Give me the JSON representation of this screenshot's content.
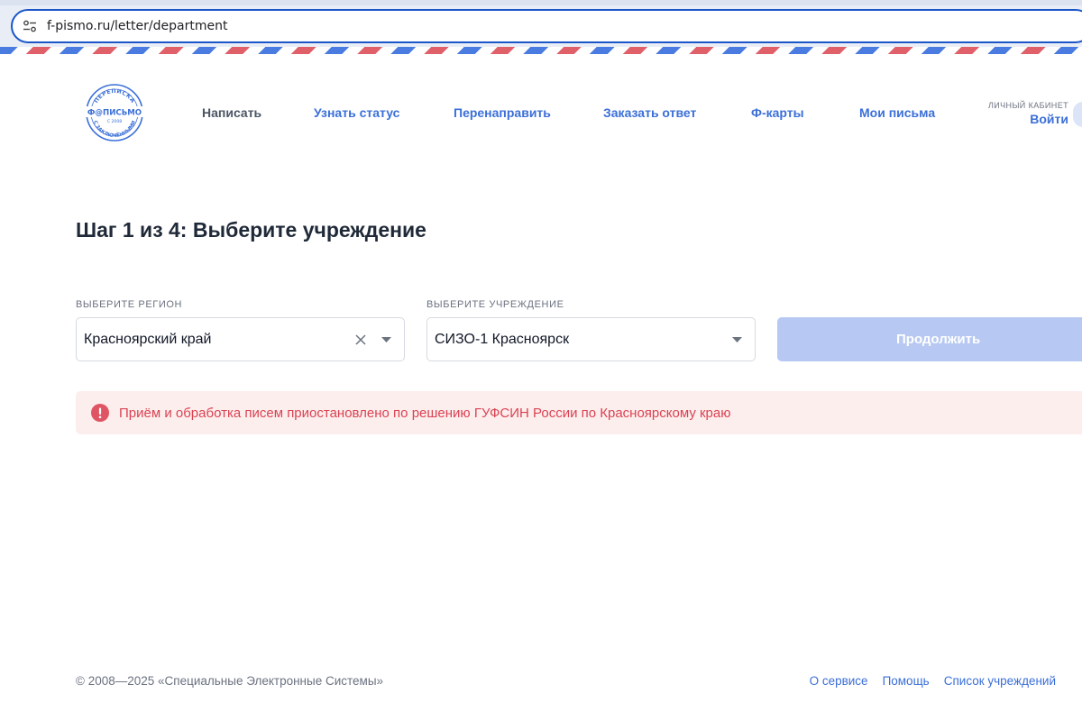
{
  "browser": {
    "url": "f-pismo.ru/letter/department",
    "site_info_icon": "tune-icon"
  },
  "logo": {
    "top_text": "ПЕРЕПИСКА",
    "main_text": "Ф@ПИСЬМО",
    "since_text": "С 2008",
    "bottom_text": "С ЗАКЛЮЧЁННЫМИ",
    "color": "#3b6fd8"
  },
  "nav": {
    "items": [
      {
        "label": "Написать"
      },
      {
        "label": "Узнать статус"
      },
      {
        "label": "Перенаправить"
      },
      {
        "label": "Заказать ответ"
      },
      {
        "label": "Ф-карты"
      },
      {
        "label": "Мои письма"
      }
    ]
  },
  "account": {
    "label": "ЛИЧНЫЙ КАБИНЕТ",
    "login": "Войти"
  },
  "step": {
    "title": "Шаг 1 из 4: Выберите учреждение"
  },
  "form": {
    "region_label": "ВЫБЕРИТЕ РЕГИОН",
    "region_value": "Красноярский край",
    "institution_label": "ВЫБЕРИТЕ УЧРЕЖДЕНИЕ",
    "institution_value": "СИЗО-1 Красноярск",
    "continue_label": "Продолжить"
  },
  "alert": {
    "text": "Приём и обработка писем приостановлено по решению ГУФСИН России по Красноярскому краю",
    "color": "#d94352"
  },
  "footer": {
    "copyright": "© 2008—2025 «Специальные Электронные Системы»",
    "links": [
      {
        "label": "О сервисе"
      },
      {
        "label": "Помощь"
      },
      {
        "label": "Список учреждений"
      }
    ]
  },
  "colors": {
    "accent": "#3b6fd8",
    "button_disabled": "#b7c9f2",
    "alert_bg": "#fdeeee",
    "airmail_blue": "#4a7be0",
    "airmail_red": "#e0606a"
  }
}
